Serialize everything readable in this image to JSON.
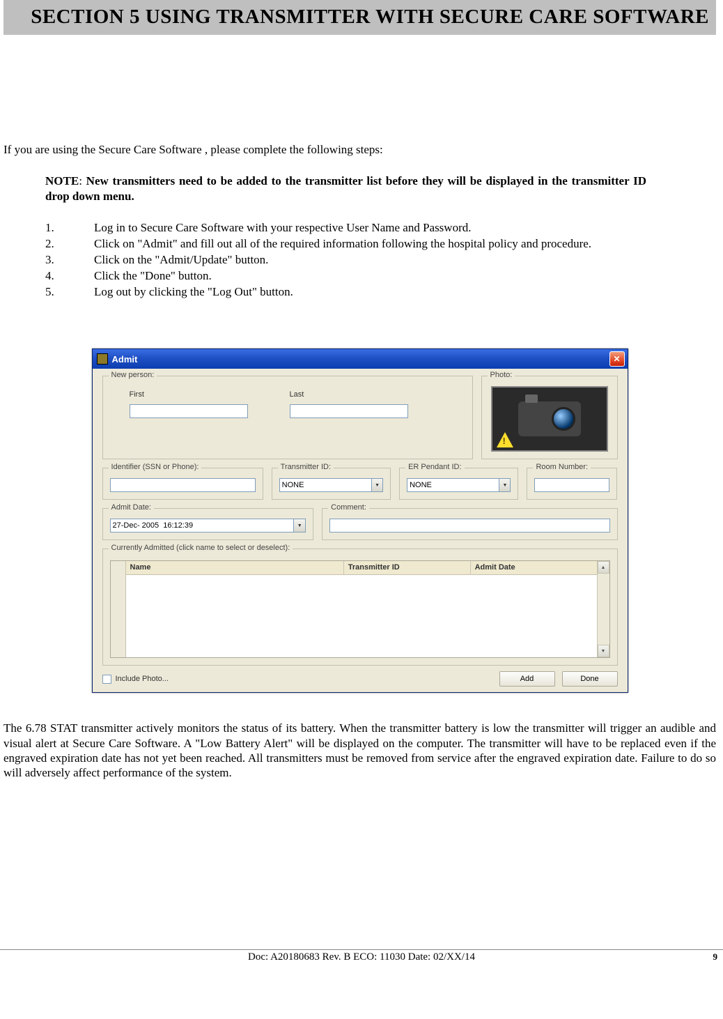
{
  "section_header": "SECTION 5   USING TRANSMITTER WITH SECURE CARE SOFTWARE",
  "intro": "If you are using the Secure Care Software , please complete the following steps:",
  "note_label": "NOTE",
  "note_text": "New transmitters need to be added to the transmitter list before they will be displayed in the transmitter ID drop down menu.",
  "steps": [
    "Log in to Secure Care Software with your respective User Name and Password.",
    "Click on \"Admit\" and fill out all of the required information following the hospital policy and procedure.",
    "Click on the \"Admit/Update\" button.",
    "Click the \"Done\" button.",
    "Log out by clicking the \"Log Out\" button."
  ],
  "about_para": "The 6.78 STAT transmitter actively monitors the status of its battery. When the transmitter battery is low the transmitter will trigger an audible and visual alert at Secure Care Software. A \"Low Battery Alert\" will be displayed on the computer. The transmitter will have to be replaced even if the engraved expiration date has not yet been reached. All transmitters must be removed from service after the engraved expiration date. Failure to do so will adversely affect performance of the system.",
  "footer_doc": "Doc: A20180683 Rev. B  ECO: 11030  Date: 02/XX/14",
  "footer_page": "9",
  "win": {
    "title": "Admit",
    "close_glyph": "✕",
    "new_person": {
      "legend": "New person:",
      "first_label": "First",
      "last_label": "Last",
      "first_value": "",
      "last_value": ""
    },
    "photo": {
      "legend": "Photo:"
    },
    "identifier": {
      "legend": "Identifier (SSN or Phone):",
      "value": ""
    },
    "transmitter": {
      "legend": "Transmitter ID:",
      "value": "NONE"
    },
    "er_pendant": {
      "legend": "ER Pendant ID:",
      "value": "NONE"
    },
    "room": {
      "legend": "Room Number:",
      "value": ""
    },
    "admit_date": {
      "legend": "Admit Date:",
      "value": "27-Dec- 2005  16:12:39"
    },
    "comment": {
      "legend": "Comment:",
      "value": ""
    },
    "currently_admitted": {
      "legend": "Currently Admitted (click name to select or deselect):",
      "cols": {
        "name": "Name",
        "tx": "Transmitter ID",
        "date": "Admit Date"
      }
    },
    "include_photo_label": "Include Photo...",
    "add_button": "Add",
    "done_button": "Done",
    "dropdown_glyph": "▼",
    "scroll_up_glyph": "▲",
    "scroll_down_glyph": "▼"
  }
}
